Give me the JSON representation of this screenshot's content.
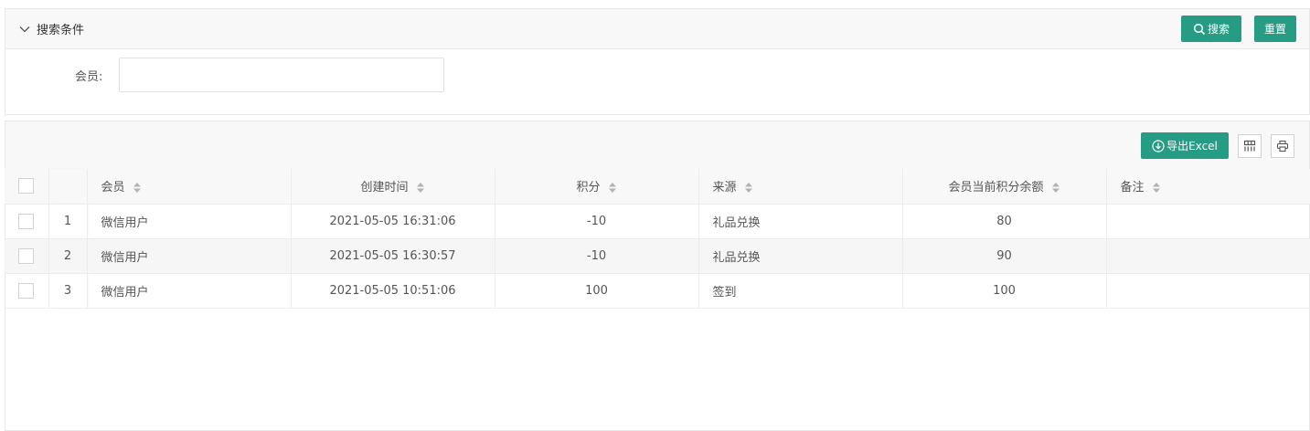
{
  "search_panel": {
    "toggle_label": "搜索条件",
    "search_button": "搜索",
    "reset_button": "重置",
    "member_label": "会员:",
    "member_value": "",
    "member_placeholder": ""
  },
  "table_panel": {
    "export_button": "导出Excel",
    "columns": [
      "会员",
      "创建时间",
      "积分",
      "来源",
      "会员当前积分余额",
      "备注"
    ],
    "rows": [
      {
        "index": "1",
        "member": "微信用户",
        "created": "2021-05-05 16:31:06",
        "points": "-10",
        "source": "礼品兑换",
        "balance": "80",
        "remark": ""
      },
      {
        "index": "2",
        "member": "微信用户",
        "created": "2021-05-05 16:30:57",
        "points": "-10",
        "source": "礼品兑换",
        "balance": "90",
        "remark": ""
      },
      {
        "index": "3",
        "member": "微信用户",
        "created": "2021-05-05 10:51:06",
        "points": "100",
        "source": "签到",
        "balance": "100",
        "remark": ""
      }
    ]
  },
  "colors": {
    "primary": "#279c84",
    "header_bg": "#f8f8f8",
    "border": "#ececec"
  }
}
